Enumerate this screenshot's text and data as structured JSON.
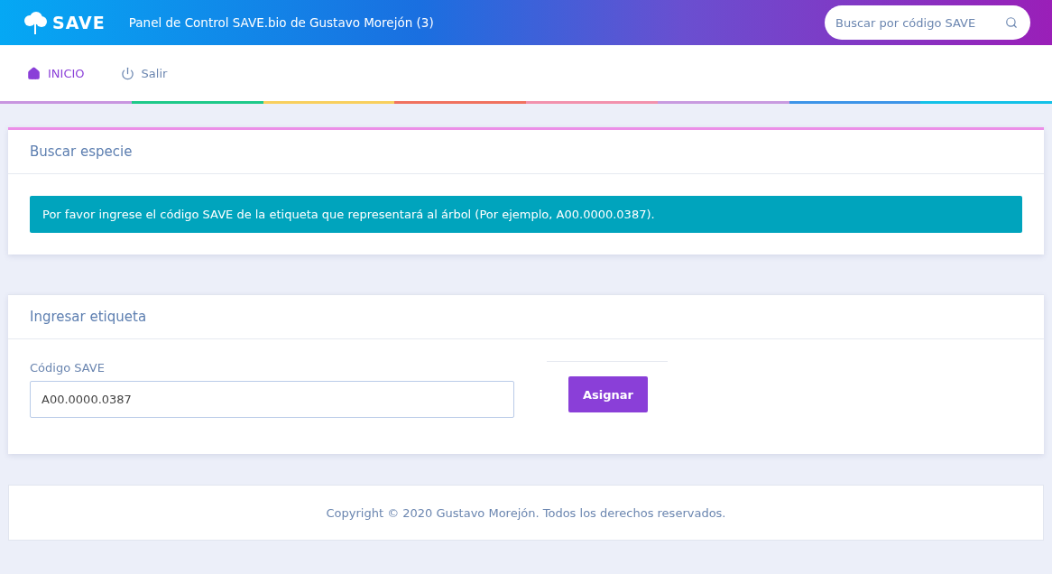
{
  "header": {
    "logo": "SAVE",
    "title": "Panel de Control SAVE.bio de Gustavo Morejón (3)",
    "search": {
      "placeholder": "Buscar por código SAVE"
    }
  },
  "nav": [
    {
      "label": "INICIO",
      "selected": true
    },
    {
      "label": "Salir",
      "selected": false
    }
  ],
  "cards": [
    {
      "title": "Buscar especie",
      "kind": "alert",
      "text": "Por favor ingrese el código SAVE de la etiqueta que representará al árbol (Por ejemplo, A00.0000.0387)."
    },
    {
      "title": "Ingresar etiqueta",
      "kind": "form",
      "label": "Código SAVE",
      "value": "A00.0000.0387",
      "button": "Asignar"
    }
  ],
  "footer": "Copyright © 2020 Gustavo Morejón. Todos los derechos reservados."
}
